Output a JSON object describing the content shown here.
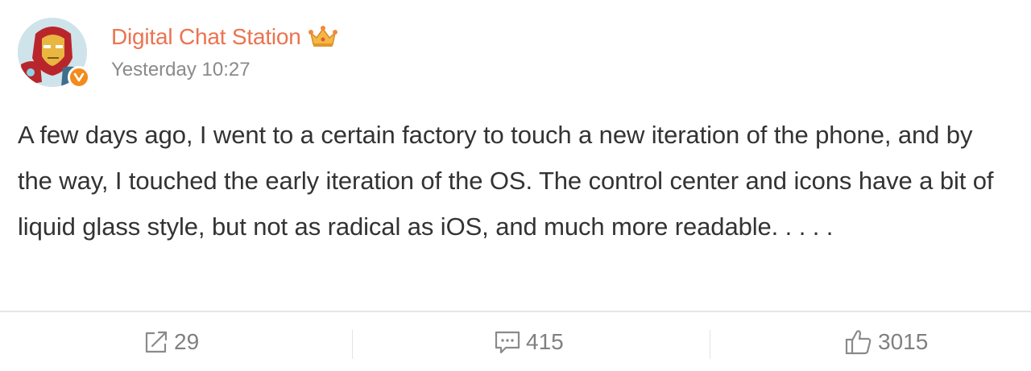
{
  "post": {
    "author": {
      "name": "Digital Chat Station",
      "verified": true,
      "badge_icon": "crown-icon",
      "avatar_icon": "iron-man-avatar-icon"
    },
    "timestamp": "Yesterday 10:27",
    "text": "A few days ago, I went to a certain factory to touch a new iteration of the phone, and by the way, I touched the early iteration of the OS. The control center and icons have a bit of liquid glass style, but not as radical as iOS, and much more readable. . . . ."
  },
  "actions": {
    "repost": {
      "icon": "repost-icon",
      "count": "29"
    },
    "comment": {
      "icon": "comment-icon",
      "count": "415"
    },
    "like": {
      "icon": "thumbs-up-icon",
      "count": "3015"
    }
  },
  "colors": {
    "author_name": "#eb7350",
    "verify_badge": "#f28b1b",
    "body_text": "#333333",
    "muted_text": "#808080"
  }
}
